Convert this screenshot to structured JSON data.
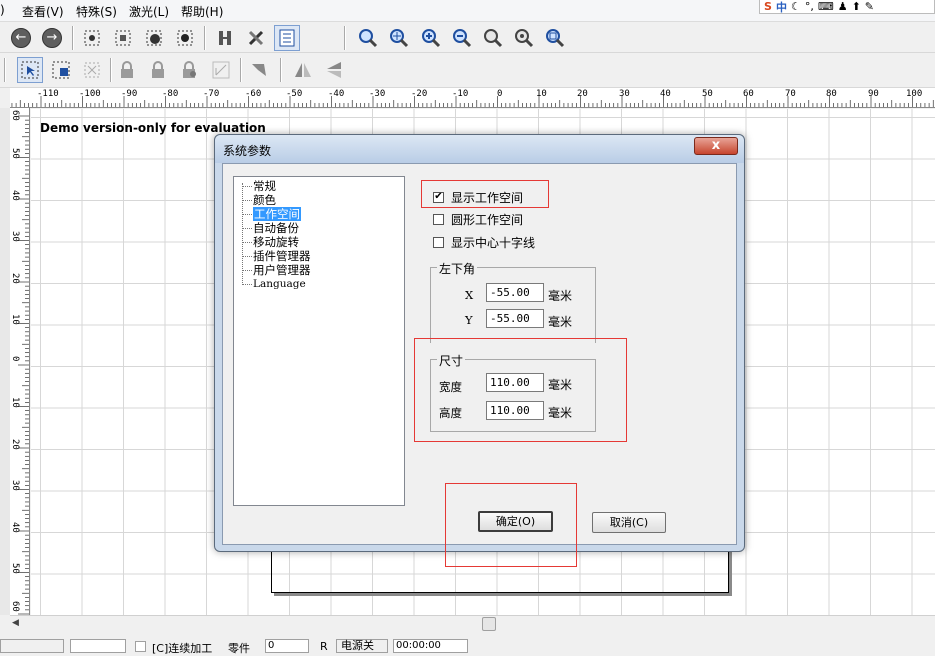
{
  "menu": {
    "items": [
      ")",
      "查看(V)",
      "特殊(S)",
      "激光(L)",
      "帮助(H)"
    ]
  },
  "ime": {
    "logo": "S",
    "lang": "中"
  },
  "ruler": {
    "h_labels": [
      "-110",
      "-100",
      "-90",
      "-80",
      "-70",
      "-60",
      "-50",
      "-40",
      "-30",
      "-20",
      "-10",
      "0",
      "10",
      "20",
      "30",
      "40",
      "50",
      "60",
      "70",
      "80",
      "90",
      "100"
    ],
    "v_labels": [
      "60",
      "50",
      "40",
      "30",
      "20",
      "10",
      "0",
      "10",
      "20",
      "30",
      "40",
      "50",
      "60"
    ]
  },
  "canvas": {
    "watermark": "Demo version-only for evaluation"
  },
  "dialog": {
    "title": "系统参数",
    "close": "x",
    "tree": [
      "常规",
      "颜色",
      "工作空间",
      "自动备份",
      "移动旋转",
      "插件管理器",
      "用户管理器",
      "Language"
    ],
    "selected_tree": "工作空间",
    "options": {
      "show_workspace": {
        "label": "显示工作空间",
        "checked": true
      },
      "circle_workspace": {
        "label": "圆形工作空间",
        "checked": false
      },
      "show_crosshair": {
        "label": "显示中心十字线",
        "checked": false
      }
    },
    "lower_left": {
      "title": "左下角",
      "x_label": "X",
      "x_value": "-55.00",
      "y_label": "Y",
      "y_value": "-55.00",
      "unit": "毫米"
    },
    "size": {
      "title": "尺寸",
      "width_label": "宽度",
      "width_value": "110.00",
      "height_label": "高度",
      "height_value": "110.00",
      "unit": "毫米"
    },
    "ok": "确定(O)",
    "cancel": "取消(C)"
  },
  "statusbar": {
    "continuous": "[C]连续加工",
    "parts_label": "零件",
    "parts_value": "0",
    "power": "电源关",
    "time": "00:00:00"
  },
  "colors": {
    "highlight": "#e53935",
    "selection": "#3399ff"
  }
}
